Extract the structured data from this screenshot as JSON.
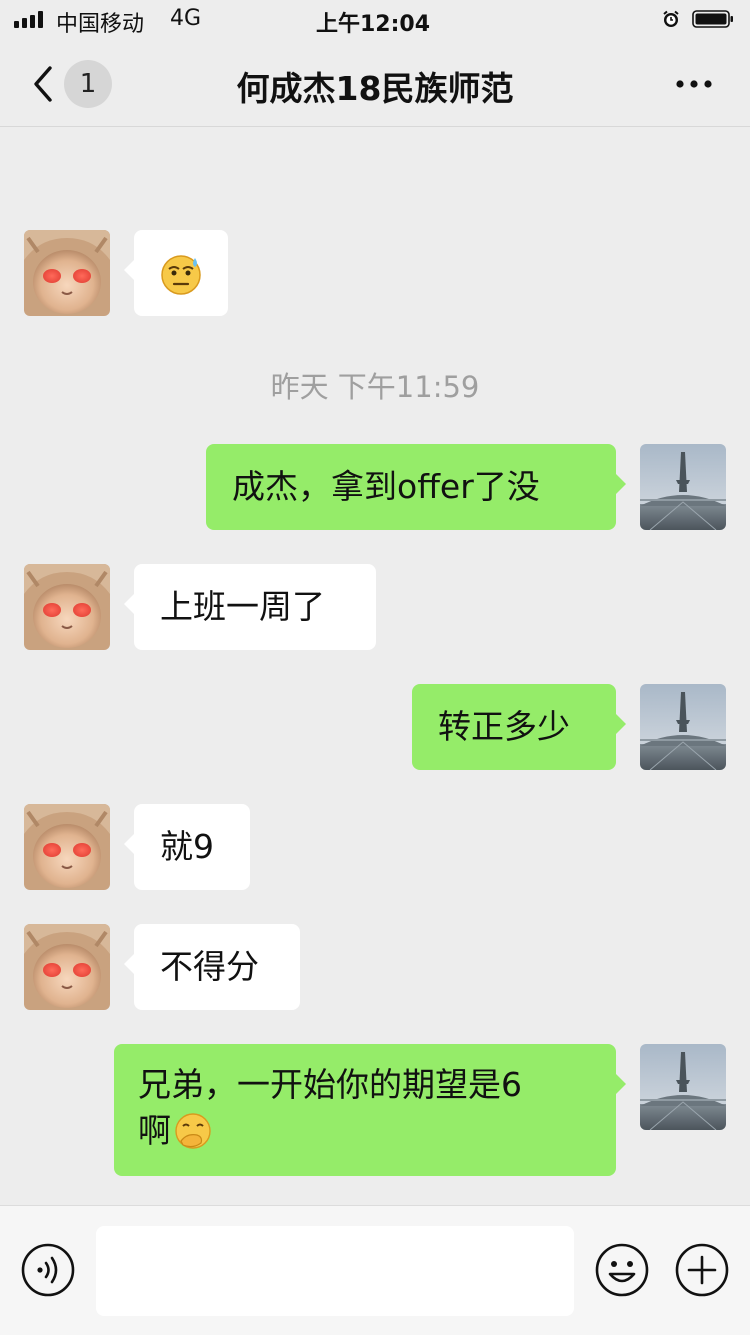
{
  "status_bar": {
    "carrier": "中国移动",
    "network": "4G",
    "time": "上午12:04",
    "alarm_icon": "alarm-icon",
    "battery_icon": "battery-icon"
  },
  "nav": {
    "back_icon": "chevron-left-icon",
    "unread_count": "1",
    "title": "何成杰18民族师范",
    "more_icon": "more-icon"
  },
  "messages": [
    {
      "side": "left",
      "emoji": "sweat-smile-emoji"
    },
    {
      "timestamp": "昨天 下午11:59"
    },
    {
      "side": "right",
      "text": "成杰，拿到offer了没"
    },
    {
      "side": "left",
      "text": "上班一周了"
    },
    {
      "side": "right",
      "text": "转正多少"
    },
    {
      "side": "left",
      "text": "就9"
    },
    {
      "side": "left",
      "text": "不得分"
    },
    {
      "side": "right",
      "text": "兄弟，一开始你的期望是6啊",
      "line1": "兄弟，一开始你的期望是6",
      "line2": "啊",
      "trailing_emoji": "face-with-hand-over-mouth-emoji"
    }
  ],
  "input_bar": {
    "voice_icon": "voice-icon",
    "placeholder": "",
    "emoji_icon": "emoji-icon",
    "plus_icon": "plus-icon"
  },
  "colors": {
    "background": "#ededed",
    "incoming_bubble": "#ffffff",
    "outgoing_bubble": "#95ec69",
    "timestamp_text": "#9f9f9f"
  }
}
